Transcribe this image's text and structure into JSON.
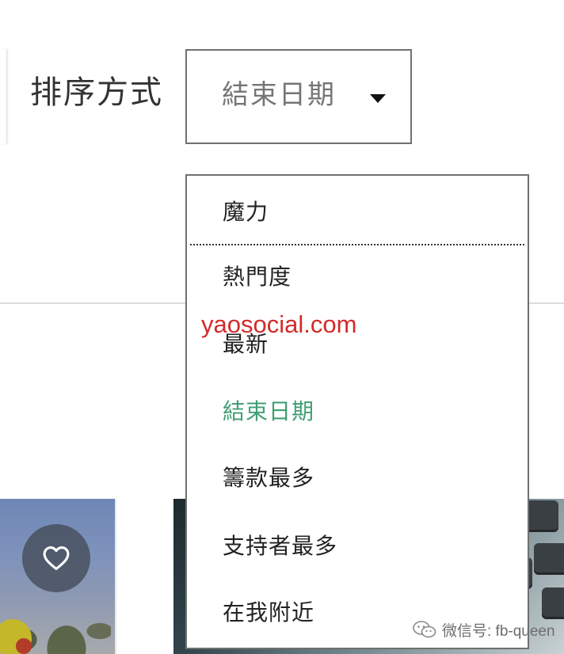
{
  "sort": {
    "label": "排序方式",
    "selected_value": "結束日期"
  },
  "dropdown": {
    "options": [
      {
        "label": "魔力",
        "selected": false
      },
      {
        "label": "熱門度",
        "selected": false
      },
      {
        "label": "最新",
        "selected": false
      },
      {
        "label": "結束日期",
        "selected": true
      },
      {
        "label": "籌款最多",
        "selected": false
      },
      {
        "label": "支持者最多",
        "selected": false
      },
      {
        "label": "在我附近",
        "selected": false
      }
    ]
  },
  "cards": {
    "favorite_icon": "heart-outline-icon"
  },
  "overlays": {
    "watermark_text": "yaosocial.com",
    "wechat_label": "微信号: fb-queen",
    "wechat_icon": "wechat-icon"
  },
  "colors": {
    "selected_option": "#3f9f72",
    "watermark": "#d32a2a",
    "select_border": "#707070"
  }
}
